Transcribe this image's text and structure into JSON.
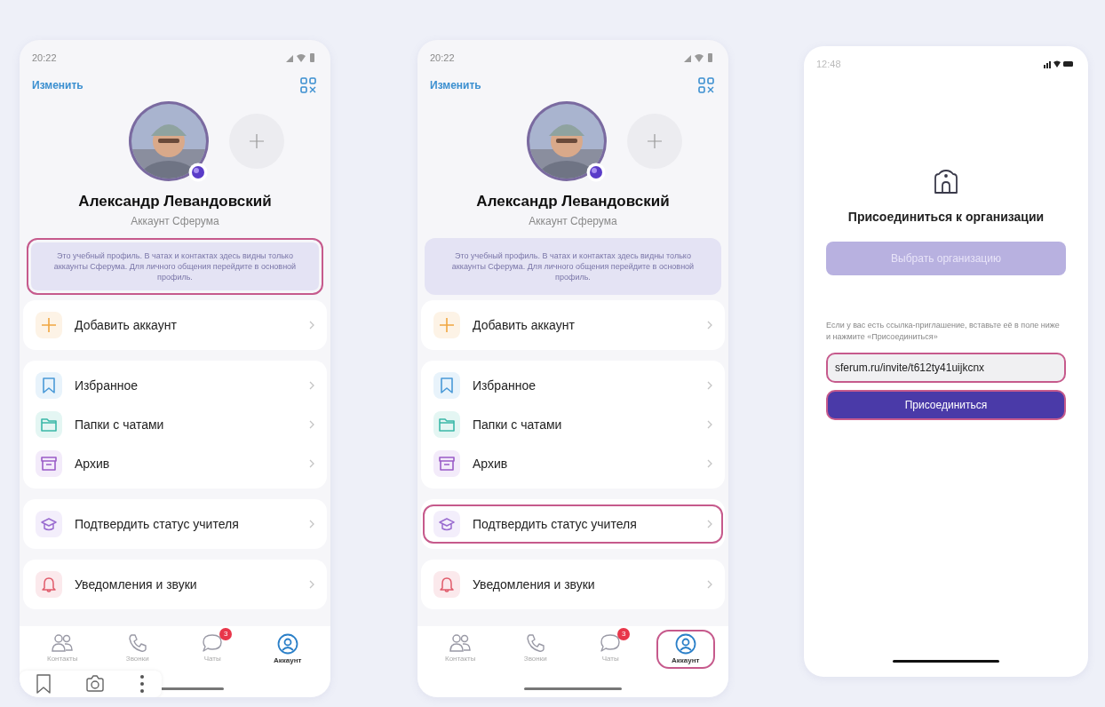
{
  "screens": [
    {
      "kind": "profile",
      "time": "20:22",
      "edit_link": "Изменить",
      "name": "Александр Левандовский",
      "subtitle": "Аккаунт Сферума",
      "notice": {
        "text": "Это учебный профиль. В чатах и контактах здесь видны только аккаунты Сферума. Для личного общения перейдите в основной профиль.",
        "highlighted": true
      },
      "menu_groups": [
        [
          {
            "kind": "plus",
            "label": "Добавить аккаунт",
            "highlighted": false
          }
        ],
        [
          {
            "kind": "bookmark",
            "label": "Избранное",
            "highlighted": false
          },
          {
            "kind": "folder",
            "label": "Папки с чатами",
            "highlighted": false
          },
          {
            "kind": "archive",
            "label": "Архив",
            "highlighted": false
          }
        ],
        [
          {
            "kind": "cap",
            "label": "Подтвердить статус учителя",
            "highlighted": false
          }
        ],
        [
          {
            "kind": "bell",
            "label": "Уведомления и звуки",
            "highlighted": false
          }
        ]
      ],
      "tabs": [
        {
          "kind": "contacts",
          "label": "Контакты",
          "selected": false,
          "highlighted": false
        },
        {
          "kind": "calls",
          "label": "Звонки",
          "selected": false,
          "highlighted": false
        },
        {
          "kind": "chats",
          "label": "Чаты",
          "selected": false,
          "highlighted": false,
          "badge": "3"
        },
        {
          "kind": "account",
          "label": "Аккаунт",
          "selected": true,
          "highlighted": false
        }
      ]
    },
    {
      "kind": "profile",
      "time": "20:22",
      "edit_link": "Изменить",
      "name": "Александр Левандовский",
      "subtitle": "Аккаунт Сферума",
      "notice": {
        "text": "Это учебный профиль. В чатах и контактах здесь видны только аккаунты Сферума. Для личного общения перейдите в основной профиль.",
        "highlighted": false
      },
      "menu_groups": [
        [
          {
            "kind": "plus",
            "label": "Добавить аккаунт",
            "highlighted": false
          }
        ],
        [
          {
            "kind": "bookmark",
            "label": "Избранное",
            "highlighted": false
          },
          {
            "kind": "folder",
            "label": "Папки с чатами",
            "highlighted": false
          },
          {
            "kind": "archive",
            "label": "Архив",
            "highlighted": false
          }
        ],
        [
          {
            "kind": "cap",
            "label": "Подтвердить статус учителя",
            "highlighted": true
          }
        ],
        [
          {
            "kind": "bell",
            "label": "Уведомления и звуки",
            "highlighted": false
          }
        ]
      ],
      "tabs": [
        {
          "kind": "contacts",
          "label": "Контакты",
          "selected": false,
          "highlighted": false
        },
        {
          "kind": "calls",
          "label": "Звонки",
          "selected": false,
          "highlighted": false
        },
        {
          "kind": "chats",
          "label": "Чаты",
          "selected": false,
          "highlighted": false,
          "badge": "3"
        },
        {
          "kind": "account",
          "label": "Аккаунт",
          "selected": true,
          "highlighted": true
        }
      ]
    },
    {
      "kind": "join",
      "time": "12:48",
      "title": "Присоединиться к организации",
      "choose_button": {
        "label": "Выбрать организацию",
        "disabled": true
      },
      "hint": "Если у вас есть ссылка-приглашение, вставьте её в поле ниже и нажмите «Присоединиться»",
      "link_field": {
        "value": "sferum.ru/invite/t612ty41uijkcnx",
        "highlighted": true
      },
      "join_button": {
        "label": "Присоединиться",
        "highlighted": true
      }
    }
  ]
}
